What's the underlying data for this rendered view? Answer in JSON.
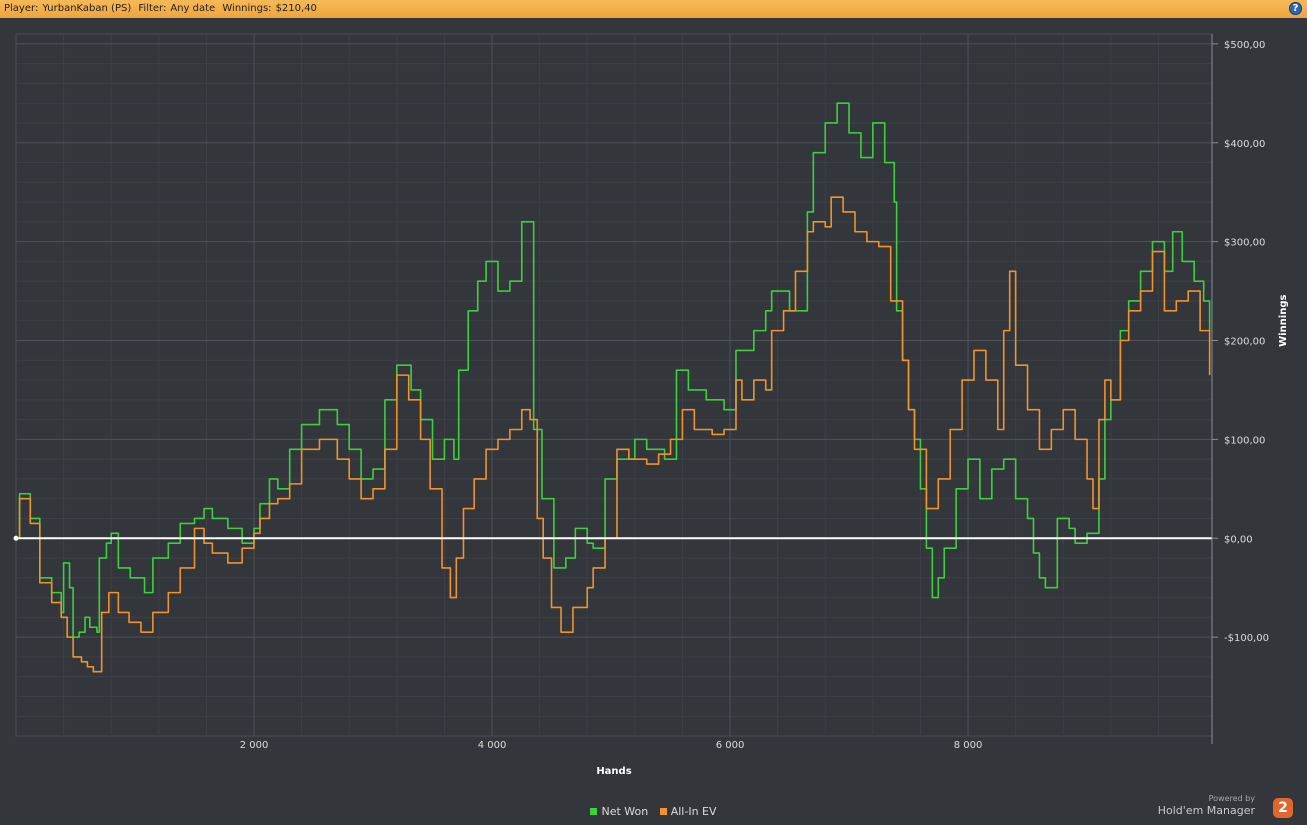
{
  "header": {
    "player_label": "Player:",
    "player": "YurbanKaban (PS)",
    "filter_label": "Filter:",
    "filter": "Any date",
    "winnings_label": "Winnings:",
    "winnings": "$210,40",
    "help_glyph": "?"
  },
  "branding": {
    "powered_by": "Powered by",
    "product": "Hold'em Manager",
    "logo_glyph": "2"
  },
  "chart_data": {
    "type": "line",
    "xlabel": "Hands",
    "ylabel": "Winnings",
    "xlim": [
      0,
      10050
    ],
    "ylim": [
      -200,
      510
    ],
    "x_ticks": [
      2000,
      4000,
      6000,
      8000
    ],
    "x_tick_labels": [
      "2 000",
      "4 000",
      "6 000",
      "8 000"
    ],
    "y_ticks": [
      -100,
      0,
      100,
      200,
      300,
      400,
      500
    ],
    "y_tick_labels": [
      "-$100,00",
      "$0,00",
      "$100,00",
      "$200,00",
      "$300,00",
      "$400,00",
      "$500,00"
    ],
    "grid": true,
    "legend_position": "bottom-center",
    "zero_line": true,
    "series": [
      {
        "name": "Net Won",
        "color": "#3dd03d",
        "points": [
          [
            0,
            0
          ],
          [
            30,
            45
          ],
          [
            120,
            20
          ],
          [
            200,
            -40
          ],
          [
            300,
            -55
          ],
          [
            380,
            -75
          ],
          [
            400,
            -25
          ],
          [
            450,
            -50
          ],
          [
            480,
            -100
          ],
          [
            530,
            -95
          ],
          [
            580,
            -80
          ],
          [
            620,
            -90
          ],
          [
            680,
            -95
          ],
          [
            700,
            -20
          ],
          [
            760,
            -5
          ],
          [
            800,
            5
          ],
          [
            860,
            -30
          ],
          [
            960,
            -40
          ],
          [
            1080,
            -55
          ],
          [
            1150,
            -20
          ],
          [
            1280,
            -5
          ],
          [
            1380,
            15
          ],
          [
            1500,
            20
          ],
          [
            1580,
            30
          ],
          [
            1650,
            20
          ],
          [
            1780,
            10
          ],
          [
            1900,
            -5
          ],
          [
            2000,
            10
          ],
          [
            2050,
            35
          ],
          [
            2130,
            60
          ],
          [
            2200,
            50
          ],
          [
            2300,
            90
          ],
          [
            2400,
            115
          ],
          [
            2550,
            130
          ],
          [
            2700,
            115
          ],
          [
            2800,
            90
          ],
          [
            2900,
            60
          ],
          [
            3000,
            70
          ],
          [
            3100,
            140
          ],
          [
            3200,
            175
          ],
          [
            3320,
            150
          ],
          [
            3400,
            120
          ],
          [
            3500,
            80
          ],
          [
            3600,
            100
          ],
          [
            3680,
            80
          ],
          [
            3720,
            170
          ],
          [
            3800,
            230
          ],
          [
            3880,
            260
          ],
          [
            3950,
            280
          ],
          [
            4050,
            250
          ],
          [
            4150,
            260
          ],
          [
            4250,
            320
          ],
          [
            4320,
            320
          ],
          [
            4350,
            110
          ],
          [
            4420,
            40
          ],
          [
            4520,
            -30
          ],
          [
            4620,
            -20
          ],
          [
            4700,
            10
          ],
          [
            4800,
            -5
          ],
          [
            4850,
            -10
          ],
          [
            4950,
            60
          ],
          [
            5050,
            80
          ],
          [
            5200,
            100
          ],
          [
            5300,
            90
          ],
          [
            5450,
            80
          ],
          [
            5550,
            170
          ],
          [
            5650,
            150
          ],
          [
            5800,
            140
          ],
          [
            5950,
            130
          ],
          [
            6050,
            190
          ],
          [
            6100,
            190
          ],
          [
            6200,
            210
          ],
          [
            6300,
            230
          ],
          [
            6350,
            250
          ],
          [
            6500,
            230
          ],
          [
            6650,
            330
          ],
          [
            6700,
            390
          ],
          [
            6800,
            420
          ],
          [
            6900,
            440
          ],
          [
            7000,
            410
          ],
          [
            7100,
            385
          ],
          [
            7200,
            420
          ],
          [
            7300,
            380
          ],
          [
            7380,
            340
          ],
          [
            7400,
            230
          ],
          [
            7450,
            180
          ],
          [
            7500,
            130
          ],
          [
            7550,
            100
          ],
          [
            7600,
            50
          ],
          [
            7650,
            -10
          ],
          [
            7700,
            -60
          ],
          [
            7750,
            -40
          ],
          [
            7800,
            -10
          ],
          [
            7900,
            50
          ],
          [
            8000,
            80
          ],
          [
            8100,
            40
          ],
          [
            8200,
            70
          ],
          [
            8300,
            80
          ],
          [
            8400,
            40
          ],
          [
            8500,
            20
          ],
          [
            8550,
            -15
          ],
          [
            8600,
            -40
          ],
          [
            8650,
            -50
          ],
          [
            8750,
            20
          ],
          [
            8850,
            10
          ],
          [
            8900,
            -5
          ],
          [
            9000,
            5
          ],
          [
            9100,
            60
          ],
          [
            9150,
            120
          ],
          [
            9200,
            140
          ],
          [
            9280,
            210
          ],
          [
            9350,
            240
          ],
          [
            9450,
            270
          ],
          [
            9550,
            300
          ],
          [
            9650,
            270
          ],
          [
            9720,
            310
          ],
          [
            9800,
            280
          ],
          [
            9900,
            260
          ],
          [
            9980,
            240
          ],
          [
            10030,
            210
          ]
        ]
      },
      {
        "name": "All-In EV",
        "color": "#f0932c",
        "points": [
          [
            0,
            0
          ],
          [
            30,
            40
          ],
          [
            120,
            15
          ],
          [
            200,
            -45
          ],
          [
            300,
            -65
          ],
          [
            380,
            -80
          ],
          [
            430,
            -100
          ],
          [
            480,
            -120
          ],
          [
            550,
            -125
          ],
          [
            600,
            -130
          ],
          [
            650,
            -135
          ],
          [
            720,
            -75
          ],
          [
            780,
            -55
          ],
          [
            860,
            -75
          ],
          [
            950,
            -85
          ],
          [
            1050,
            -95
          ],
          [
            1150,
            -75
          ],
          [
            1280,
            -55
          ],
          [
            1380,
            -30
          ],
          [
            1500,
            10
          ],
          [
            1580,
            -5
          ],
          [
            1650,
            -15
          ],
          [
            1780,
            -25
          ],
          [
            1900,
            -10
          ],
          [
            2000,
            5
          ],
          [
            2050,
            20
          ],
          [
            2130,
            35
          ],
          [
            2200,
            40
          ],
          [
            2300,
            55
          ],
          [
            2400,
            90
          ],
          [
            2550,
            100
          ],
          [
            2700,
            80
          ],
          [
            2800,
            60
          ],
          [
            2900,
            40
          ],
          [
            3000,
            50
          ],
          [
            3100,
            90
          ],
          [
            3200,
            165
          ],
          [
            3300,
            140
          ],
          [
            3400,
            100
          ],
          [
            3480,
            50
          ],
          [
            3580,
            -30
          ],
          [
            3650,
            -60
          ],
          [
            3700,
            -20
          ],
          [
            3760,
            30
          ],
          [
            3850,
            60
          ],
          [
            3950,
            90
          ],
          [
            4050,
            100
          ],
          [
            4150,
            110
          ],
          [
            4250,
            130
          ],
          [
            4320,
            120
          ],
          [
            4380,
            20
          ],
          [
            4430,
            -20
          ],
          [
            4500,
            -70
          ],
          [
            4580,
            -95
          ],
          [
            4680,
            -70
          ],
          [
            4800,
            -50
          ],
          [
            4850,
            -30
          ],
          [
            4950,
            0
          ],
          [
            5050,
            90
          ],
          [
            5150,
            80
          ],
          [
            5300,
            75
          ],
          [
            5400,
            85
          ],
          [
            5500,
            100
          ],
          [
            5600,
            130
          ],
          [
            5700,
            110
          ],
          [
            5850,
            105
          ],
          [
            5950,
            110
          ],
          [
            6050,
            160
          ],
          [
            6100,
            140
          ],
          [
            6200,
            160
          ],
          [
            6300,
            150
          ],
          [
            6350,
            210
          ],
          [
            6450,
            230
          ],
          [
            6550,
            270
          ],
          [
            6650,
            310
          ],
          [
            6700,
            320
          ],
          [
            6800,
            315
          ],
          [
            6850,
            345
          ],
          [
            6950,
            330
          ],
          [
            7050,
            310
          ],
          [
            7150,
            300
          ],
          [
            7250,
            295
          ],
          [
            7350,
            240
          ],
          [
            7450,
            180
          ],
          [
            7500,
            130
          ],
          [
            7550,
            90
          ],
          [
            7650,
            30
          ],
          [
            7750,
            60
          ],
          [
            7850,
            110
          ],
          [
            7950,
            160
          ],
          [
            8050,
            190
          ],
          [
            8150,
            160
          ],
          [
            8250,
            110
          ],
          [
            8300,
            210
          ],
          [
            8350,
            270
          ],
          [
            8400,
            175
          ],
          [
            8500,
            130
          ],
          [
            8600,
            90
          ],
          [
            8700,
            110
          ],
          [
            8800,
            130
          ],
          [
            8900,
            100
          ],
          [
            9000,
            60
          ],
          [
            9050,
            30
          ],
          [
            9100,
            120
          ],
          [
            9150,
            160
          ],
          [
            9200,
            140
          ],
          [
            9280,
            200
          ],
          [
            9350,
            230
          ],
          [
            9450,
            250
          ],
          [
            9550,
            290
          ],
          [
            9650,
            230
          ],
          [
            9750,
            240
          ],
          [
            9850,
            250
          ],
          [
            9950,
            210
          ],
          [
            10030,
            165
          ]
        ]
      }
    ]
  }
}
